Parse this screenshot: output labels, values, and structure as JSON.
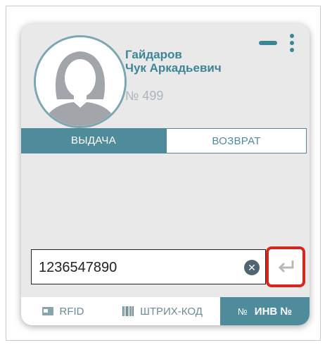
{
  "user": {
    "surname": "Гайдаров",
    "name": "Чук Аркадьевич",
    "number": "№ 499"
  },
  "tabs": {
    "issue": "ВЫДАЧА",
    "return": "ВОЗВРАТ",
    "active": "issue"
  },
  "search": {
    "value": "1236547890"
  },
  "modes": {
    "rfid": "RFID",
    "barcode": "ШТРИХ-КОД",
    "inventory_icon": "№",
    "inventory": "ИНВ №",
    "active": "inventory"
  },
  "colors": {
    "accent": "#4f8c9b",
    "name_text": "#3d8596",
    "highlight_border": "#d9261c"
  },
  "icons": {
    "menu": "minimize-icon",
    "more": "kebab-menu-icon",
    "clear": "clear-icon",
    "enter": "enter-icon",
    "rfid": "rfid-card-icon",
    "barcode": "barcode-icon"
  }
}
